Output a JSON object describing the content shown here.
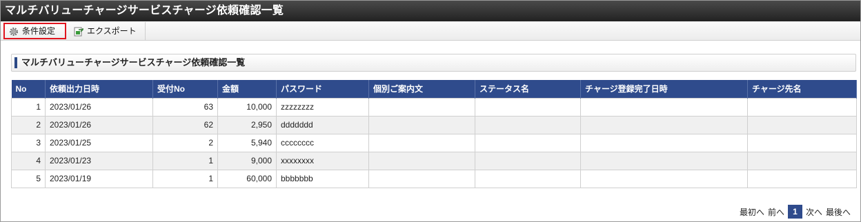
{
  "window": {
    "title": "マルチバリューチャージサービスチャージ依頼確認一覧"
  },
  "toolbar": {
    "condition_label": "条件設定",
    "condition_icon": "gear-icon",
    "export_label": "エクスポート",
    "export_icon": "export-icon"
  },
  "section": {
    "title": "マルチバリューチャージサービスチャージ依頼確認一覧"
  },
  "table": {
    "columns": [
      "No",
      "依頼出力日時",
      "受付No",
      "金額",
      "パスワード",
      "個別ご案内文",
      "ステータス名",
      "チャージ登録完了日時",
      "チャージ先名"
    ],
    "rows": [
      [
        "1",
        "2023/01/26",
        "63",
        "10,000",
        "zzzzzzzz",
        "",
        "",
        "",
        ""
      ],
      [
        "2",
        "2023/01/26",
        "62",
        "2,950",
        "ddddddd",
        "",
        "",
        "",
        ""
      ],
      [
        "3",
        "2023/01/25",
        "2",
        "5,940",
        "cccccccc",
        "",
        "",
        "",
        ""
      ],
      [
        "4",
        "2023/01/23",
        "1",
        "9,000",
        "xxxxxxxx",
        "",
        "",
        "",
        ""
      ],
      [
        "5",
        "2023/01/19",
        "1",
        "60,000",
        "bbbbbbb",
        "",
        "",
        "",
        ""
      ]
    ]
  },
  "pager": {
    "first_label": "最初へ",
    "prev_label": "前へ",
    "current_page": "1",
    "next_label": "次へ",
    "last_label": "最後へ"
  },
  "colors": {
    "header_bg": "#2f4b8c",
    "titlebar_bg": "#222222",
    "highlight_border": "#e0141e",
    "alt_row_bg": "#f0f0f0"
  }
}
